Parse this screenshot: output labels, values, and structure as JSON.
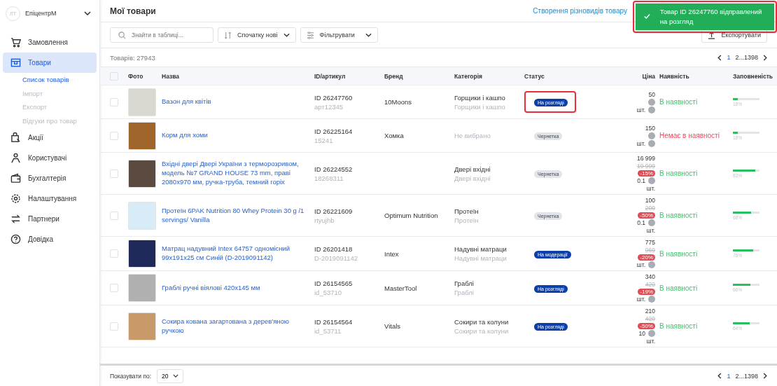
{
  "sidebar": {
    "avatar": "ЛТ",
    "account": "ЕпіцентрМ",
    "items": [
      {
        "label": "Замовлення",
        "selected": false
      },
      {
        "label": "Товари",
        "selected": true,
        "children": [
          {
            "label": "Список товарів",
            "selected": true
          },
          {
            "label": "Імпорт",
            "selected": false
          },
          {
            "label": "Експорт",
            "selected": false
          },
          {
            "label": "Відгуки про товар",
            "selected": false
          }
        ]
      },
      {
        "label": "Акції",
        "selected": false
      },
      {
        "label": "Користувачі",
        "selected": false
      },
      {
        "label": "Бухгалтерія",
        "selected": false
      },
      {
        "label": "Налаштування",
        "selected": false
      },
      {
        "label": "Партнери",
        "selected": false
      },
      {
        "label": "Довідка",
        "selected": false
      }
    ]
  },
  "page": {
    "title": "Мої товари",
    "variants_link": "Створення різновидів товару"
  },
  "toolbar": {
    "search_placeholder": "Знайти в таблиці...",
    "sort": "Спочатку нові",
    "filter": "Фільтрувати",
    "export": "Експортувати"
  },
  "count": "Товарів: 27943",
  "pagination": {
    "pages": [
      {
        "label": "1",
        "selected": true
      },
      {
        "label": "2...1398",
        "selected": false
      }
    ]
  },
  "table": {
    "all_checked": false,
    "columns": [
      "Фото",
      "Назва",
      "ID/артикул",
      "Бренд",
      "Категорія",
      "Статус",
      "Ціна",
      "Наявність",
      "Заповненість"
    ],
    "rows": [
      {
        "checked": false,
        "name": "Вазон для квітів",
        "id": "ID 26247760",
        "sku": "арт12345",
        "brand": "10Moons",
        "category": "Горщики і кашпо",
        "category_sub": "Горщики і кашпо",
        "status": {
          "label": "На розгляді",
          "kind": "review"
        },
        "highlighted": true,
        "price": "50",
        "unit": "шт.",
        "in_stock": true,
        "stock": "В наявності",
        "level": 0.18,
        "fill": "18%"
      },
      {
        "checked": false,
        "name": "Корм для хоми",
        "id": "ID 26225164",
        "sku": "15241",
        "brand": "Хомка",
        "category": "Не вибрано",
        "status": {
          "label": "Чернетка",
          "kind": "draft"
        },
        "highlighted": false,
        "price": "150",
        "unit": "шт.",
        "in_stock": false,
        "stock": "Немає в наявності",
        "level": 0.18,
        "fill": "18%"
      },
      {
        "checked": false,
        "name": "Вхідні двері Двері України з терморозривом, модель №7 GRAND HOUSE 73 mm, праві 2080x970 мм, ручка-труба, темний горіх",
        "id": "ID 26224552",
        "sku": "18268311",
        "category": "Двері вхідні",
        "category_sub": "Двері вхідні",
        "status": {
          "label": "Чернетка",
          "kind": "draft"
        },
        "highlighted": false,
        "price": "16 999",
        "old_price": "19 999",
        "discount": "-15%",
        "qty": "0.1",
        "unit": "шт.",
        "in_stock": true,
        "stock": "В наявності",
        "level": 0.83,
        "fill": "83%"
      },
      {
        "checked": false,
        "name": "Протеїн 6PAK Nutrition 80 Whey Protein 30 g /1 servings/ Vanilla",
        "id": "ID 26221609",
        "sku": "rtyujhb",
        "brand": "Optimum Nutrition",
        "category": "Протеїн",
        "category_sub": "Протеїн",
        "status": {
          "label": "Чернетка",
          "kind": "draft"
        },
        "highlighted": false,
        "price": "100",
        "old_price": "200",
        "discount": "-50%",
        "qty": "0.1",
        "unit": "шт.",
        "in_stock": true,
        "stock": "В наявності",
        "level": 0.68,
        "fill": "68%"
      },
      {
        "checked": false,
        "name": "Матрац надувний Intex 64757 одномісний 99x191x25 см Синій (D-2019091142)",
        "id": "ID 26201418",
        "sku": "D-2019091142",
        "brand": "Intex",
        "category": "Надувні матраци",
        "category_sub": "Надувні матраци",
        "status": {
          "label": "На модерації",
          "kind": "moderation"
        },
        "highlighted": false,
        "price": "775",
        "old_price": "969",
        "discount": "-20%",
        "unit": "шт.",
        "in_stock": true,
        "stock": "В наявності",
        "level": 0.76,
        "fill": "76%"
      },
      {
        "checked": false,
        "name": "Граблі ручні віялові 420x145 мм",
        "id": "ID 26154565",
        "sku": "id_53710",
        "brand": "MasterTool",
        "category": "Граблі",
        "category_sub": "Граблі",
        "status": {
          "label": "На розгляді",
          "kind": "review"
        },
        "highlighted": false,
        "price": "340",
        "old_price": "420",
        "discount": "-19%",
        "unit": "шт.",
        "in_stock": true,
        "stock": "В наявності",
        "level": 0.66,
        "fill": "66%"
      },
      {
        "checked": false,
        "name": "Сокира кована загартована з дерев'яною ручкою",
        "id": "ID 26154564",
        "sku": "id_53711",
        "brand": "Vitals",
        "category": "Сокири та колуни",
        "category_sub": "Сокири та колуни",
        "status": {
          "label": "На розгляді",
          "kind": "review"
        },
        "highlighted": false,
        "price": "210",
        "old_price": "420",
        "discount": "-50%",
        "qty": "10",
        "unit": "шт.",
        "in_stock": true,
        "stock": "В наявності",
        "level": 0.64,
        "fill": "64%"
      }
    ]
  },
  "footer": {
    "page_size_label": "Показувати по:",
    "page_size": "20",
    "pages": [
      {
        "label": "1",
        "selected": true
      },
      {
        "label": "2...1398",
        "selected": false
      }
    ]
  },
  "toast": {
    "message": "Товар ID 26247760 відправлений на розгляд",
    "highlighted": true
  }
}
